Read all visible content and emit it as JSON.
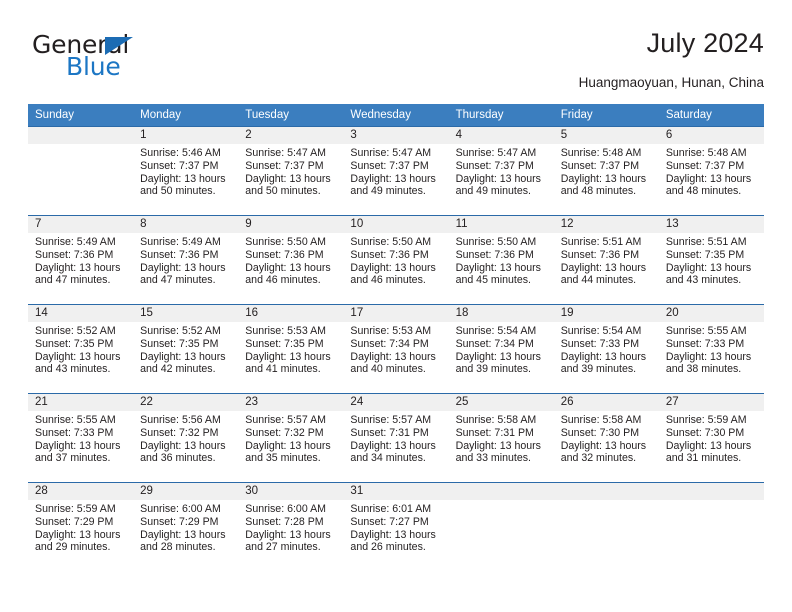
{
  "brand": {
    "name_part1": "General",
    "name_part2": "Blue",
    "triangle_color": "#1c6cb4",
    "blue_color": "#1c76c4"
  },
  "header": {
    "title": "July 2024",
    "subtitle": "Huangmaoyuan, Hunan, China"
  },
  "theme": {
    "header_row_bg": "#3b7ebf",
    "rule_color": "#2b6aa8",
    "day_number_bg": "#f0f0f0",
    "text_color": "#231f20"
  },
  "weekdays": [
    "Sunday",
    "Monday",
    "Tuesday",
    "Wednesday",
    "Thursday",
    "Friday",
    "Saturday"
  ],
  "weeks": [
    [
      {
        "day": "",
        "sunrise": "",
        "sunset": "",
        "daylight1": "",
        "daylight2": ""
      },
      {
        "day": "1",
        "sunrise": "Sunrise: 5:46 AM",
        "sunset": "Sunset: 7:37 PM",
        "daylight1": "Daylight: 13 hours",
        "daylight2": "and 50 minutes."
      },
      {
        "day": "2",
        "sunrise": "Sunrise: 5:47 AM",
        "sunset": "Sunset: 7:37 PM",
        "daylight1": "Daylight: 13 hours",
        "daylight2": "and 50 minutes."
      },
      {
        "day": "3",
        "sunrise": "Sunrise: 5:47 AM",
        "sunset": "Sunset: 7:37 PM",
        "daylight1": "Daylight: 13 hours",
        "daylight2": "and 49 minutes."
      },
      {
        "day": "4",
        "sunrise": "Sunrise: 5:47 AM",
        "sunset": "Sunset: 7:37 PM",
        "daylight1": "Daylight: 13 hours",
        "daylight2": "and 49 minutes."
      },
      {
        "day": "5",
        "sunrise": "Sunrise: 5:48 AM",
        "sunset": "Sunset: 7:37 PM",
        "daylight1": "Daylight: 13 hours",
        "daylight2": "and 48 minutes."
      },
      {
        "day": "6",
        "sunrise": "Sunrise: 5:48 AM",
        "sunset": "Sunset: 7:37 PM",
        "daylight1": "Daylight: 13 hours",
        "daylight2": "and 48 minutes."
      }
    ],
    [
      {
        "day": "7",
        "sunrise": "Sunrise: 5:49 AM",
        "sunset": "Sunset: 7:36 PM",
        "daylight1": "Daylight: 13 hours",
        "daylight2": "and 47 minutes."
      },
      {
        "day": "8",
        "sunrise": "Sunrise: 5:49 AM",
        "sunset": "Sunset: 7:36 PM",
        "daylight1": "Daylight: 13 hours",
        "daylight2": "and 47 minutes."
      },
      {
        "day": "9",
        "sunrise": "Sunrise: 5:50 AM",
        "sunset": "Sunset: 7:36 PM",
        "daylight1": "Daylight: 13 hours",
        "daylight2": "and 46 minutes."
      },
      {
        "day": "10",
        "sunrise": "Sunrise: 5:50 AM",
        "sunset": "Sunset: 7:36 PM",
        "daylight1": "Daylight: 13 hours",
        "daylight2": "and 46 minutes."
      },
      {
        "day": "11",
        "sunrise": "Sunrise: 5:50 AM",
        "sunset": "Sunset: 7:36 PM",
        "daylight1": "Daylight: 13 hours",
        "daylight2": "and 45 minutes."
      },
      {
        "day": "12",
        "sunrise": "Sunrise: 5:51 AM",
        "sunset": "Sunset: 7:36 PM",
        "daylight1": "Daylight: 13 hours",
        "daylight2": "and 44 minutes."
      },
      {
        "day": "13",
        "sunrise": "Sunrise: 5:51 AM",
        "sunset": "Sunset: 7:35 PM",
        "daylight1": "Daylight: 13 hours",
        "daylight2": "and 43 minutes."
      }
    ],
    [
      {
        "day": "14",
        "sunrise": "Sunrise: 5:52 AM",
        "sunset": "Sunset: 7:35 PM",
        "daylight1": "Daylight: 13 hours",
        "daylight2": "and 43 minutes."
      },
      {
        "day": "15",
        "sunrise": "Sunrise: 5:52 AM",
        "sunset": "Sunset: 7:35 PM",
        "daylight1": "Daylight: 13 hours",
        "daylight2": "and 42 minutes."
      },
      {
        "day": "16",
        "sunrise": "Sunrise: 5:53 AM",
        "sunset": "Sunset: 7:35 PM",
        "daylight1": "Daylight: 13 hours",
        "daylight2": "and 41 minutes."
      },
      {
        "day": "17",
        "sunrise": "Sunrise: 5:53 AM",
        "sunset": "Sunset: 7:34 PM",
        "daylight1": "Daylight: 13 hours",
        "daylight2": "and 40 minutes."
      },
      {
        "day": "18",
        "sunrise": "Sunrise: 5:54 AM",
        "sunset": "Sunset: 7:34 PM",
        "daylight1": "Daylight: 13 hours",
        "daylight2": "and 39 minutes."
      },
      {
        "day": "19",
        "sunrise": "Sunrise: 5:54 AM",
        "sunset": "Sunset: 7:33 PM",
        "daylight1": "Daylight: 13 hours",
        "daylight2": "and 39 minutes."
      },
      {
        "day": "20",
        "sunrise": "Sunrise: 5:55 AM",
        "sunset": "Sunset: 7:33 PM",
        "daylight1": "Daylight: 13 hours",
        "daylight2": "and 38 minutes."
      }
    ],
    [
      {
        "day": "21",
        "sunrise": "Sunrise: 5:55 AM",
        "sunset": "Sunset: 7:33 PM",
        "daylight1": "Daylight: 13 hours",
        "daylight2": "and 37 minutes."
      },
      {
        "day": "22",
        "sunrise": "Sunrise: 5:56 AM",
        "sunset": "Sunset: 7:32 PM",
        "daylight1": "Daylight: 13 hours",
        "daylight2": "and 36 minutes."
      },
      {
        "day": "23",
        "sunrise": "Sunrise: 5:57 AM",
        "sunset": "Sunset: 7:32 PM",
        "daylight1": "Daylight: 13 hours",
        "daylight2": "and 35 minutes."
      },
      {
        "day": "24",
        "sunrise": "Sunrise: 5:57 AM",
        "sunset": "Sunset: 7:31 PM",
        "daylight1": "Daylight: 13 hours",
        "daylight2": "and 34 minutes."
      },
      {
        "day": "25",
        "sunrise": "Sunrise: 5:58 AM",
        "sunset": "Sunset: 7:31 PM",
        "daylight1": "Daylight: 13 hours",
        "daylight2": "and 33 minutes."
      },
      {
        "day": "26",
        "sunrise": "Sunrise: 5:58 AM",
        "sunset": "Sunset: 7:30 PM",
        "daylight1": "Daylight: 13 hours",
        "daylight2": "and 32 minutes."
      },
      {
        "day": "27",
        "sunrise": "Sunrise: 5:59 AM",
        "sunset": "Sunset: 7:30 PM",
        "daylight1": "Daylight: 13 hours",
        "daylight2": "and 31 minutes."
      }
    ],
    [
      {
        "day": "28",
        "sunrise": "Sunrise: 5:59 AM",
        "sunset": "Sunset: 7:29 PM",
        "daylight1": "Daylight: 13 hours",
        "daylight2": "and 29 minutes."
      },
      {
        "day": "29",
        "sunrise": "Sunrise: 6:00 AM",
        "sunset": "Sunset: 7:29 PM",
        "daylight1": "Daylight: 13 hours",
        "daylight2": "and 28 minutes."
      },
      {
        "day": "30",
        "sunrise": "Sunrise: 6:00 AM",
        "sunset": "Sunset: 7:28 PM",
        "daylight1": "Daylight: 13 hours",
        "daylight2": "and 27 minutes."
      },
      {
        "day": "31",
        "sunrise": "Sunrise: 6:01 AM",
        "sunset": "Sunset: 7:27 PM",
        "daylight1": "Daylight: 13 hours",
        "daylight2": "and 26 minutes."
      },
      {
        "day": "",
        "sunrise": "",
        "sunset": "",
        "daylight1": "",
        "daylight2": ""
      },
      {
        "day": "",
        "sunrise": "",
        "sunset": "",
        "daylight1": "",
        "daylight2": ""
      },
      {
        "day": "",
        "sunrise": "",
        "sunset": "",
        "daylight1": "",
        "daylight2": ""
      }
    ]
  ]
}
